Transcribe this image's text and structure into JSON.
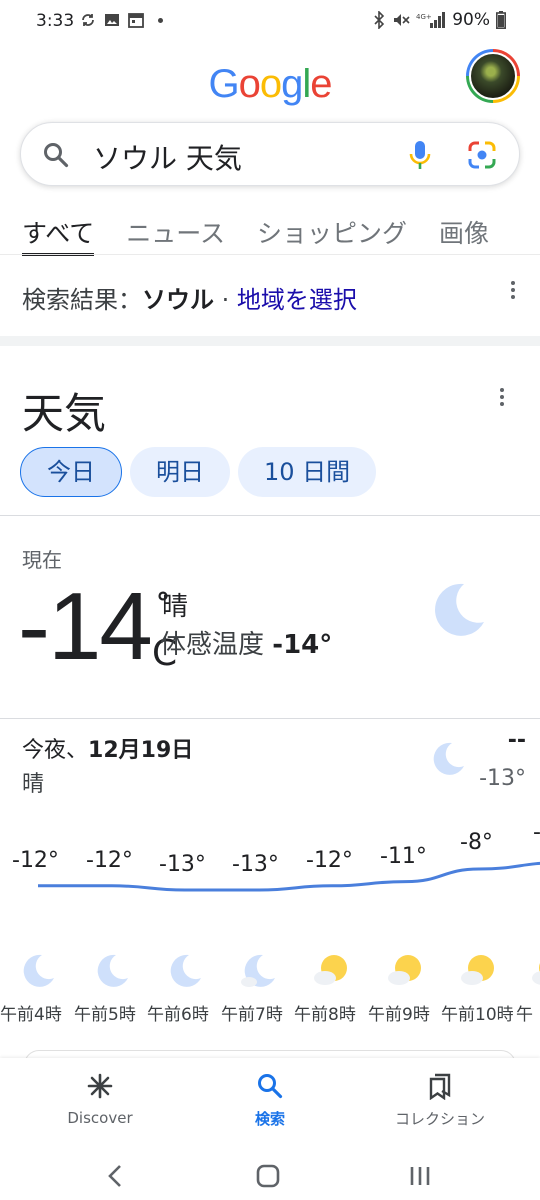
{
  "status_bar": {
    "time": "3:33",
    "battery": "90%",
    "icons": [
      "sync-icon",
      "image-icon",
      "calendar-icon",
      "bluetooth-icon",
      "mute-icon",
      "signal-icon",
      "battery-icon"
    ]
  },
  "header": {
    "logo_letters": [
      "G",
      "o",
      "o",
      "g",
      "l",
      "e"
    ],
    "logo_colors": [
      "#4285F4",
      "#EA4335",
      "#FBBC05",
      "#4285F4",
      "#34A853",
      "#EA4335"
    ]
  },
  "search": {
    "query": "ソウル 天気"
  },
  "tabs": [
    {
      "label": "すべて",
      "active": true
    },
    {
      "label": "ニュース",
      "active": false
    },
    {
      "label": "ショッピング",
      "active": false
    },
    {
      "label": "画像",
      "active": false
    }
  ],
  "results_for": {
    "prefix": "検索結果：",
    "location": "ソウル",
    "separator": " · ",
    "choose_region": "地域を選択"
  },
  "weather": {
    "title": "天気",
    "chips": [
      {
        "label": "今日",
        "active": true
      },
      {
        "label": "明日",
        "active": false
      },
      {
        "label": "10 日間",
        "active": false
      }
    ],
    "now_label": "現在",
    "temperature": "-14",
    "degree_symbol": "°",
    "unit": "C",
    "condition": "晴",
    "feels_like_label": "体感温度",
    "feels_like_value": "-14°",
    "tonight_prefix": "今夜、",
    "tonight_date": "12月19日",
    "tonight_condition": "晴",
    "high": "--",
    "low": "-13°",
    "hourly": [
      {
        "temp": "-12°",
        "time": "午前4時",
        "icon": "moon"
      },
      {
        "temp": "-12°",
        "time": "午前5時",
        "icon": "moon"
      },
      {
        "temp": "-13°",
        "time": "午前6時",
        "icon": "moon"
      },
      {
        "temp": "-13°",
        "time": "午前7時",
        "icon": "moon-cloud"
      },
      {
        "temp": "-12°",
        "time": "午前8時",
        "icon": "sun-cloud"
      },
      {
        "temp": "-11°",
        "time": "午前9時",
        "icon": "sun-cloud"
      },
      {
        "temp": "-8°",
        "time": "午前10時",
        "icon": "sun-cloud"
      },
      {
        "temp": "-",
        "time": "午",
        "icon": "sun-cloud"
      }
    ]
  },
  "bottom_nav": [
    {
      "label": "Discover",
      "icon": "asterisk-icon",
      "active": false
    },
    {
      "label": "検索",
      "icon": "search-icon",
      "active": true
    },
    {
      "label": "コレクション",
      "icon": "collections-icon",
      "active": false
    }
  ],
  "system_nav": [
    "back-icon",
    "home-icon",
    "recents-icon"
  ]
}
